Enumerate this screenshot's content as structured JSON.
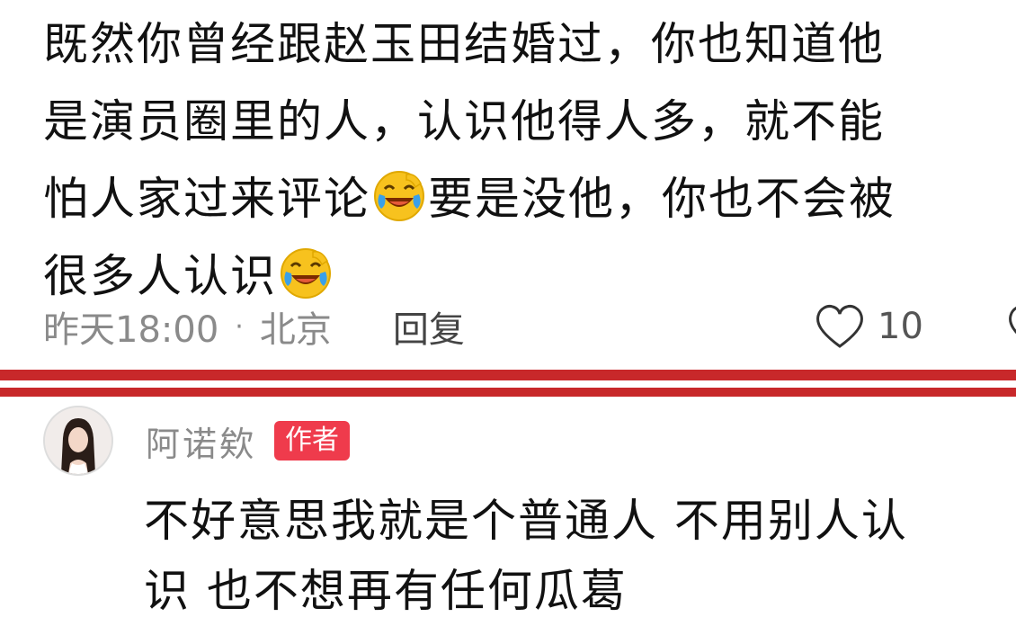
{
  "comment1": {
    "line1": "既然你曾经跟赵玉田结婚过，你也知道他",
    "line2": "是演员圈里的人，认识他得人多，就不能",
    "line3_before": "怕人家过来评论",
    "line3_after": "要是没他，你也不会被",
    "line4": "很多人认识",
    "emoji_icon": "laughing-crying-emoji",
    "time": "昨天18:00",
    "separator": "·",
    "location": "北京",
    "reply_label": "回复",
    "likes": "10"
  },
  "reply": {
    "username": "阿诺欸",
    "badge": "作者",
    "line1": "不好意思我就是个普通人 不用别人认",
    "line2": "识 也不想再有任何瓜葛"
  },
  "colors": {
    "divider_red": "#c8282a",
    "badge_red": "#ef3b4c",
    "meta_gray": "#8a8a8a"
  }
}
